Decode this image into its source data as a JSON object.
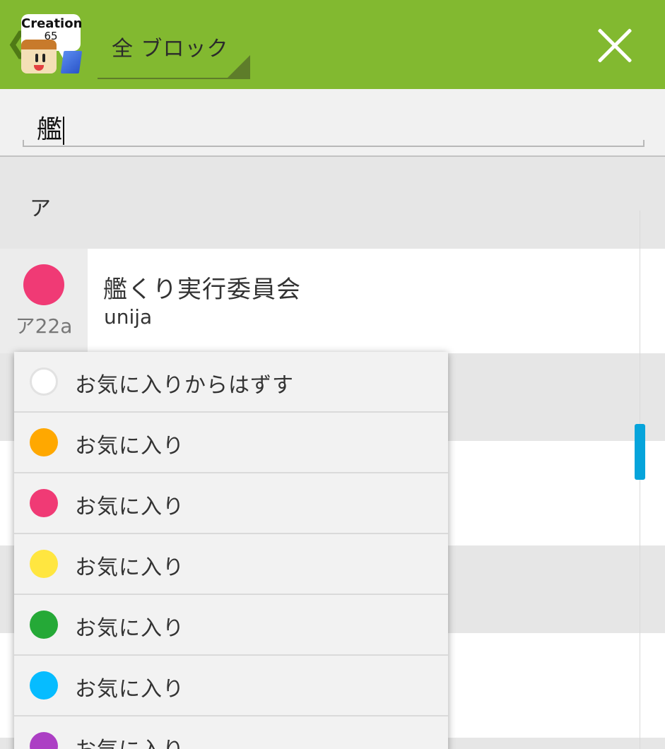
{
  "header": {
    "logo": {
      "line1": "Creation",
      "line2": "65"
    },
    "dropdown_label": "全 ブロック",
    "colors": {
      "bar": "#82b930",
      "dark_accent": "#5e7d2a"
    }
  },
  "search": {
    "value": "艦"
  },
  "section": {
    "label": "ア"
  },
  "result": {
    "code": "ア22a",
    "title": "艦くり実行委員会",
    "subtitle": "unija",
    "dot_color": "#f03a75"
  },
  "menu": {
    "items": [
      {
        "label": "お気に入りからはずす",
        "color": "#ffffff",
        "empty": true
      },
      {
        "label": "お気に入り",
        "color": "#ffa800"
      },
      {
        "label": "お気に入り",
        "color": "#f03a75"
      },
      {
        "label": "お気に入り",
        "color": "#ffe640"
      },
      {
        "label": "お気に入り",
        "color": "#25a937"
      },
      {
        "label": "お気に入り",
        "color": "#06bcff"
      },
      {
        "label": "お気に入り",
        "color": "#ac3fc4"
      }
    ]
  },
  "scrollbar": {
    "color": "#06a4db"
  }
}
